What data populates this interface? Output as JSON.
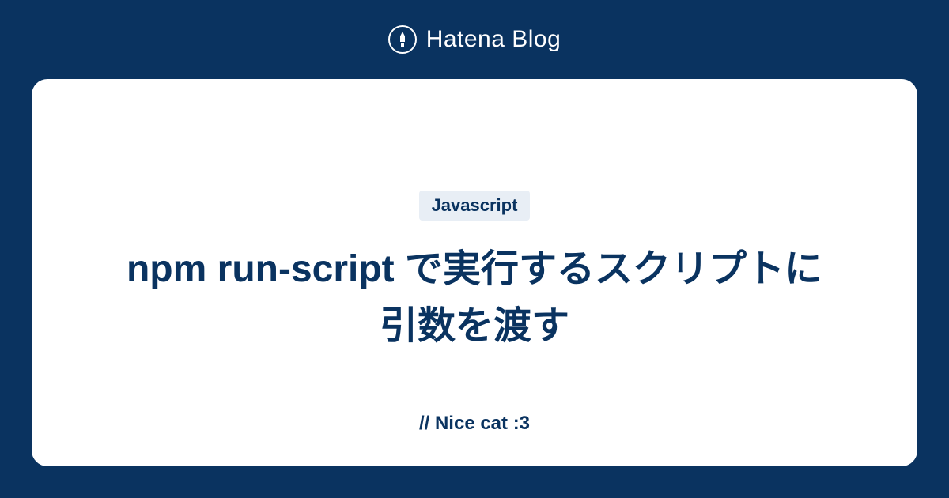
{
  "header": {
    "brand_text": "Hatena Blog"
  },
  "card": {
    "tag": "Javascript",
    "title": "npm run-script で実行するスクリプトに引数を渡す",
    "footer": "// Nice cat :3"
  }
}
